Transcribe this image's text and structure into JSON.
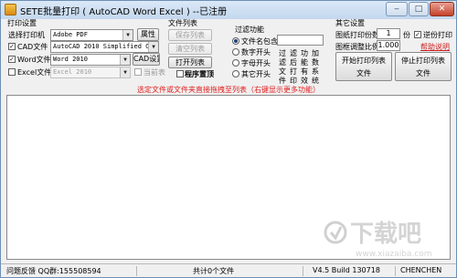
{
  "window": {
    "title": "SETE批量打印 ( AutoCAD Word Excel ) --已注册"
  },
  "caption": {
    "minimize": "‒",
    "maximize": "□",
    "close": "✕"
  },
  "print_settings": {
    "group_title": "打印设置",
    "printer_label": "选择打印机",
    "printer_value": "Adobe PDF",
    "properties_button": "属性",
    "cad_label": "CAD文件",
    "cad_checked": true,
    "cad_value": "AutoCAD 2010 Simplified Chines",
    "word_label": "Word文件",
    "word_checked": true,
    "word_value": "Word 2010",
    "cad_settings_button": "CAD设置",
    "excel_label": "Excel文件",
    "excel_checked": false,
    "excel_value": "Excel 2010",
    "current_sheet_label": "当前表",
    "current_sheet_checked": false
  },
  "file_list": {
    "group_title": "文件列表",
    "save_list_button": "保存列表",
    "clear_list_button": "清空列表",
    "open_list_button": "打开列表",
    "top_most_label": "程序置顶",
    "top_most_checked": false
  },
  "filter": {
    "group_title": "过滤功能",
    "options": [
      "文件名包含",
      "数字开头",
      "字母开头",
      "其它开头"
    ],
    "selected_index": 0,
    "text_value": "",
    "filter_buttons": [
      {
        "label": "过滤文件"
      },
      {
        "label": "滤后打印"
      },
      {
        "label": "功能有效"
      },
      {
        "label": "加数系统"
      }
    ]
  },
  "other_settings": {
    "group_title": "其它设置",
    "copies_label": "图纸打印份数",
    "copies_value": "1",
    "copies_unit": "份",
    "scale_label": "图框调整比例",
    "scale_value": "1.000",
    "reverse_label": "逆份打印",
    "reverse_checked": true,
    "help_link": "帮助说明",
    "start_print_button": "开始打印列表文件",
    "stop_print_button": "停止打印列表文件"
  },
  "hint": "选定文件或文件夹直接拖拽至列表（右键显示更多功能）",
  "status": {
    "feedback": "问题反馈 QQ群:155508594",
    "count": "共计0个文件",
    "version": "V4.5 Build 130718",
    "user": "CHENCHEN"
  },
  "watermark": {
    "text": "下载吧",
    "domain": "www.xiazaiba.com"
  },
  "colors": {
    "hint": "#e02020",
    "link": "#cc2020",
    "title_bar": "#c3d7ee"
  }
}
